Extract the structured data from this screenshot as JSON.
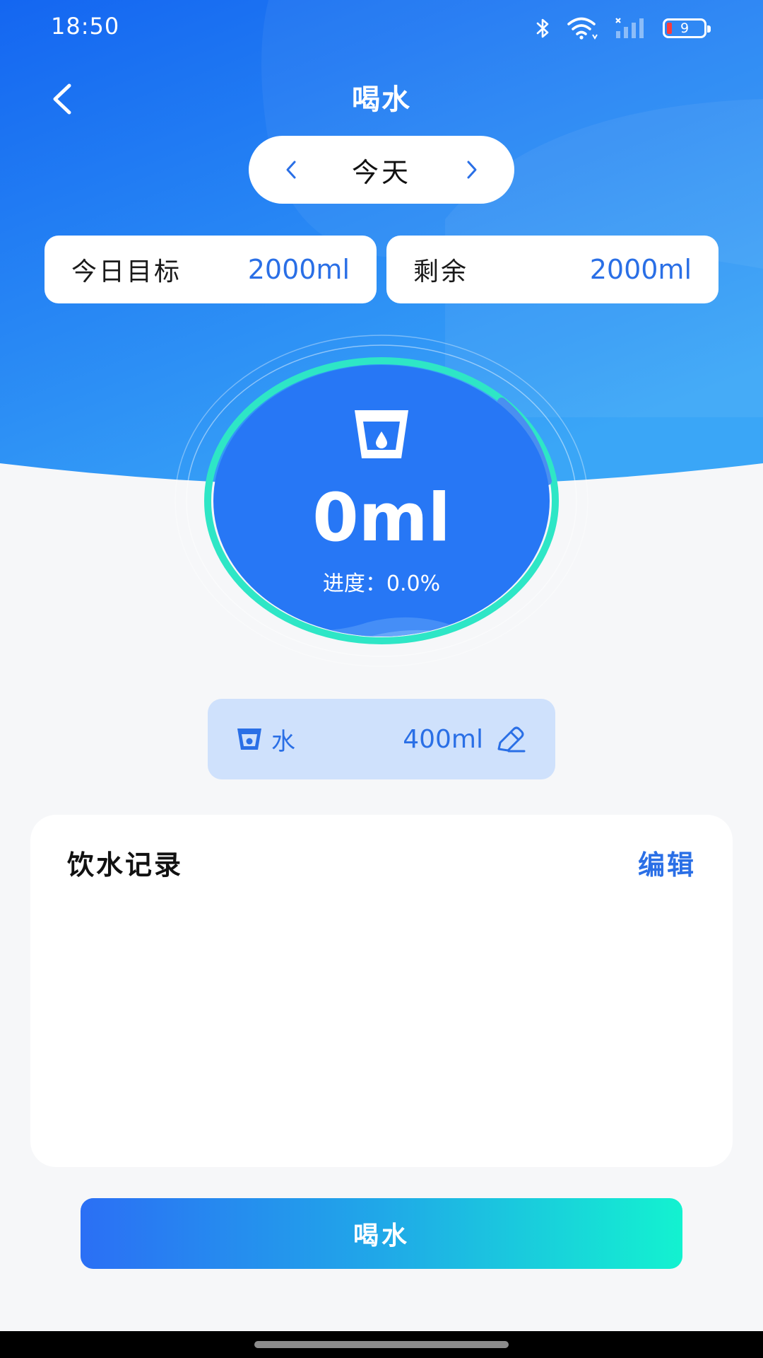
{
  "status_bar": {
    "time": "18:50",
    "battery_level": "9",
    "icons": [
      "bluetooth-icon",
      "wifi-icon",
      "signal-icon",
      "battery-icon"
    ]
  },
  "header": {
    "title": "喝水",
    "back_icon": "chevron-left-icon"
  },
  "date_selector": {
    "label": "今天",
    "prev_icon": "chevron-left-icon",
    "next_icon": "chevron-right-icon"
  },
  "stats": {
    "goal_label": "今日目标",
    "goal_value": "2000ml",
    "remaining_label": "剩余",
    "remaining_value": "2000ml"
  },
  "progress": {
    "amount": "0ml",
    "text": "进度：0.0%",
    "fraction": 0.0
  },
  "drink_selector": {
    "name": "水",
    "amount": "400ml",
    "icon": "cup-icon",
    "edit_icon": "pencil-icon"
  },
  "records": {
    "title": "饮水记录",
    "edit_label": "编辑"
  },
  "primary_button": {
    "label": "喝水"
  },
  "colors": {
    "primary": "#2a6fe6",
    "circle_fill": "#2777f5",
    "ring": "#2ee6c6",
    "hero_top": "#1a6ef2",
    "hero_bottom": "#39a8f7",
    "selector_bg": "#cfe1fc"
  }
}
